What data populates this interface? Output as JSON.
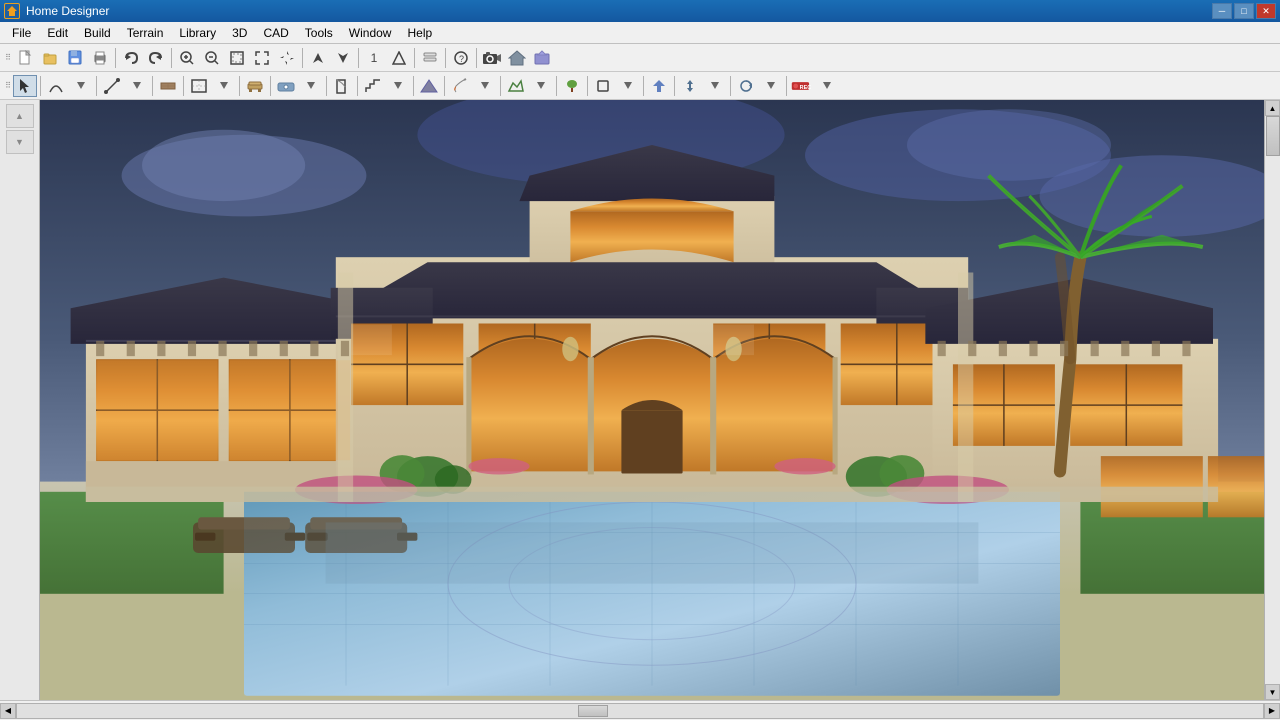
{
  "app": {
    "title": "Home Designer",
    "icon_label": "HD"
  },
  "titlebar": {
    "minimize": "─",
    "maximize": "□",
    "close": "✕"
  },
  "menubar": {
    "items": [
      "File",
      "Edit",
      "Build",
      "Terrain",
      "Library",
      "3D",
      "CAD",
      "Tools",
      "Window",
      "Help"
    ]
  },
  "toolbar1": {
    "buttons": [
      {
        "name": "new",
        "icon": "📄",
        "label": "New"
      },
      {
        "name": "open",
        "icon": "📂",
        "label": "Open"
      },
      {
        "name": "save",
        "icon": "💾",
        "label": "Save"
      },
      {
        "name": "print",
        "icon": "🖨",
        "label": "Print"
      },
      {
        "name": "undo",
        "icon": "↩",
        "label": "Undo"
      },
      {
        "name": "redo",
        "icon": "↪",
        "label": "Redo"
      },
      {
        "name": "zoom-in",
        "icon": "🔍",
        "label": "Zoom In"
      },
      {
        "name": "zoom-out",
        "icon": "🔍",
        "label": "Zoom Out"
      },
      {
        "name": "zoom-fit",
        "icon": "⊡",
        "label": "Fit View"
      },
      {
        "name": "zoom-ext",
        "icon": "⤢",
        "label": "Zoom Extents"
      },
      {
        "name": "pan",
        "icon": "✋",
        "label": "Pan"
      },
      {
        "name": "arrow-up",
        "icon": "↑",
        "label": "Arrow Up"
      },
      {
        "name": "arrow-dwn",
        "icon": "↓",
        "label": "Arrow Down"
      },
      {
        "name": "counter",
        "icon": "1",
        "label": "Counter"
      },
      {
        "name": "move-up",
        "icon": "▲",
        "label": "Move Up"
      },
      {
        "name": "layers",
        "icon": "≡",
        "label": "Layers"
      },
      {
        "name": "help-q",
        "icon": "?",
        "label": "Help"
      },
      {
        "name": "camera",
        "icon": "📷",
        "label": "Camera"
      },
      {
        "name": "house",
        "icon": "🏠",
        "label": "House"
      },
      {
        "name": "export",
        "icon": "📤",
        "label": "Export"
      }
    ]
  },
  "toolbar2": {
    "buttons": [
      {
        "name": "select",
        "icon": "↖",
        "label": "Select"
      },
      {
        "name": "arc",
        "icon": "⌒",
        "label": "Arc"
      },
      {
        "name": "line",
        "icon": "─",
        "label": "Line"
      },
      {
        "name": "wall",
        "icon": "▬",
        "label": "Wall"
      },
      {
        "name": "room",
        "icon": "⬜",
        "label": "Room"
      },
      {
        "name": "furniture",
        "icon": "🪑",
        "label": "Furniture"
      },
      {
        "name": "object",
        "icon": "◉",
        "label": "Object"
      },
      {
        "name": "cut",
        "icon": "✂",
        "label": "Cut"
      },
      {
        "name": "stair",
        "icon": "▤",
        "label": "Stair"
      },
      {
        "name": "terrain2",
        "icon": "△",
        "label": "Terrain"
      },
      {
        "name": "paint",
        "icon": "🖌",
        "label": "Paint"
      },
      {
        "name": "material",
        "icon": "◈",
        "label": "Material"
      },
      {
        "name": "plant",
        "icon": "🌿",
        "label": "Plant"
      },
      {
        "name": "shape",
        "icon": "◻",
        "label": "Shape"
      },
      {
        "name": "roof",
        "icon": "⌂",
        "label": "Roof"
      },
      {
        "name": "export2",
        "icon": "↗",
        "label": "Export"
      },
      {
        "name": "arrows",
        "icon": "↕",
        "label": "Arrows"
      },
      {
        "name": "transform",
        "icon": "⟳",
        "label": "Transform"
      },
      {
        "name": "record",
        "icon": "⏺",
        "label": "Record"
      }
    ]
  },
  "viewport": {
    "scene": "3D House Render - Mediterranean Villa with Pool"
  },
  "statusbar": {
    "left_arrow": "◀",
    "right_arrow": "▶",
    "up_arrow": "▲",
    "down_arrow": "▼"
  }
}
